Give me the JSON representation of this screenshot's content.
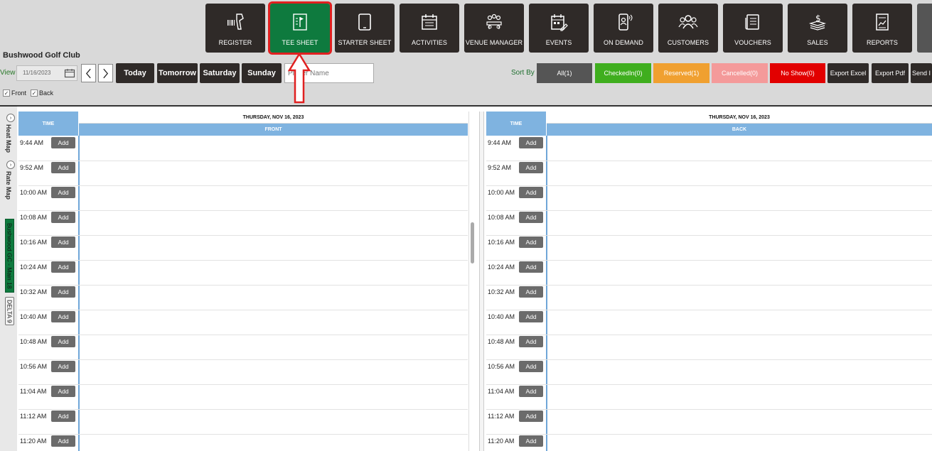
{
  "nav": [
    {
      "label": "REGISTER",
      "icon": "barcode-scanner-icon"
    },
    {
      "label": "TEE SHEET",
      "icon": "tee-flag-sheet-icon",
      "active": true
    },
    {
      "label": "STARTER SHEET",
      "icon": "tablet-icon"
    },
    {
      "label": "ACTIVITIES",
      "icon": "calendar-icon"
    },
    {
      "label": "VENUE MANAGER",
      "icon": "group-table-icon"
    },
    {
      "label": "EVENTS",
      "icon": "calendar-edit-icon"
    },
    {
      "label": "ON DEMAND",
      "icon": "mobile-user-icon"
    },
    {
      "label": "CUSTOMERS",
      "icon": "users-icon"
    },
    {
      "label": "VOUCHERS",
      "icon": "voucher-list-icon"
    },
    {
      "label": "SALES",
      "icon": "money-icon"
    },
    {
      "label": "REPORTS",
      "icon": "report-icon"
    }
  ],
  "club_name": "Bushwood Golf Club",
  "toolbar": {
    "view_label": "View",
    "date_value": "11/16/2023",
    "days": [
      "Today",
      "Tomorrow",
      "Saturday",
      "Sunday"
    ],
    "player_placeholder": "Player Name",
    "sort_label": "Sort By",
    "sort": [
      {
        "label": "All(1)",
        "color": "#555555"
      },
      {
        "label": "CheckedIn(0)",
        "color": "#3fae1e"
      },
      {
        "label": "Reserved(1)",
        "color": "#f0a030"
      },
      {
        "label": "Cancelled(0)",
        "color": "#f49a9a"
      },
      {
        "label": "No Show(0)",
        "color": "#e20000"
      }
    ],
    "export": [
      "Export Excel",
      "Export Pdf",
      "Send I"
    ]
  },
  "filters": [
    {
      "label": "Front",
      "checked": true
    },
    {
      "label": "Back",
      "checked": true
    }
  ],
  "side_tabs": {
    "heat_map": "Heat Map",
    "rate_map": "Rate Map",
    "course": "Bushwood GC - Main 18",
    "delta": "DELTA 9"
  },
  "grid": {
    "time_header": "TIME",
    "date_header": "THURSDAY, NOV 16, 2023",
    "front_label": "FRONT",
    "back_label": "BACK",
    "add_label": "Add",
    "times": [
      "9:44 AM",
      "9:52 AM",
      "10:00 AM",
      "10:08 AM",
      "10:16 AM",
      "10:24 AM",
      "10:32 AM",
      "10:40 AM",
      "10:48 AM",
      "10:56 AM",
      "11:04 AM",
      "11:12 AM",
      "11:20 AM"
    ]
  }
}
